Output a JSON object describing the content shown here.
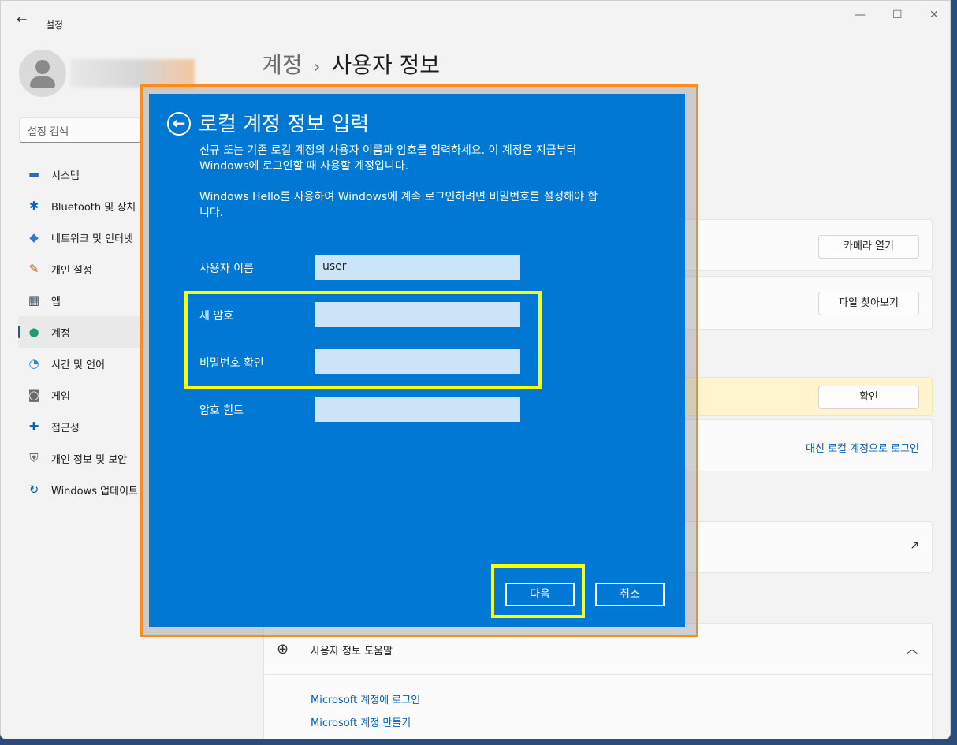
{
  "window": {
    "title": "설정",
    "back_icon": "back-arrow-icon",
    "controls": {
      "minimize": "—",
      "maximize": "☐",
      "close": "✕"
    }
  },
  "search": {
    "placeholder": "설정 검색"
  },
  "sidebar": {
    "items": [
      {
        "label": "시스템",
        "icon": "monitor-icon",
        "glyph": "▬",
        "color": "#2b6cb0"
      },
      {
        "label": "Bluetooth 및 장치",
        "icon": "bluetooth-icon",
        "glyph": "✱",
        "color": "#0067c0"
      },
      {
        "label": "네트워크 및 인터넷",
        "icon": "wifi-icon",
        "glyph": "◆",
        "color": "#2b7fd4"
      },
      {
        "label": "개인 설정",
        "icon": "brush-icon",
        "glyph": "✎",
        "color": "#c75b1a"
      },
      {
        "label": "앱",
        "icon": "apps-icon",
        "glyph": "▦",
        "color": "#3a4a5c"
      },
      {
        "label": "계정",
        "icon": "account-icon",
        "glyph": "●",
        "color": "#1f9b6e",
        "active": true
      },
      {
        "label": "시간 및 언어",
        "icon": "clock-globe-icon",
        "glyph": "◔",
        "color": "#2b7fd4"
      },
      {
        "label": "게임",
        "icon": "gamepad-icon",
        "glyph": "◙",
        "color": "#6b6b6b"
      },
      {
        "label": "접근성",
        "icon": "accessibility-icon",
        "glyph": "✚",
        "color": "#005fb8"
      },
      {
        "label": "개인 정보 및 보안",
        "icon": "shield-icon",
        "glyph": "⛨",
        "color": "#6b6b6b"
      },
      {
        "label": "Windows 업데이트",
        "icon": "update-icon",
        "glyph": "↻",
        "color": "#005fb8"
      }
    ]
  },
  "breadcrumb": {
    "parent": "계정",
    "separator": "›",
    "current": "사용자 정보"
  },
  "cards": {
    "camera_button": "카메라 열기",
    "browse_button": "파일 찾아보기",
    "confirm_button": "확인",
    "local_account_link": "대신 로컬 계정으로 로그인",
    "external_icon": "↗"
  },
  "help": {
    "title": "사용자 정보 도움말",
    "chevron": "︿",
    "links": [
      "Microsoft 계정에 로그인",
      "Microsoft 계정 만들기"
    ]
  },
  "dialog": {
    "back_icon": "←",
    "title": "로컬 계정 정보 입력",
    "desc1_line1": "신규 또는 기존 로컬 계정의 사용자 이름과 암호를 입력하세요. 이 계정은 지금부터",
    "desc1_line2": "Windows에 로그인할 때 사용할 계정입니다.",
    "desc2_line1": "Windows Hello를 사용하여 Windows에 계속 로그인하려면 비밀번호를 설정해야 합",
    "desc2_line2": "니다.",
    "fields": {
      "username_label": "사용자 이름",
      "username_value": "user",
      "new_password_label": "새 암호",
      "new_password_value": "",
      "confirm_label": "비밀번호 확인",
      "confirm_value": "",
      "hint_label": "암호 힌트",
      "hint_value": ""
    },
    "next_button": "다음",
    "cancel_button": "취소"
  },
  "colors": {
    "dialog_bg": "#0078d4",
    "annotation_orange": "#ff8c1a",
    "annotation_yellow": "#ffff00",
    "accent": "#005fb8"
  }
}
